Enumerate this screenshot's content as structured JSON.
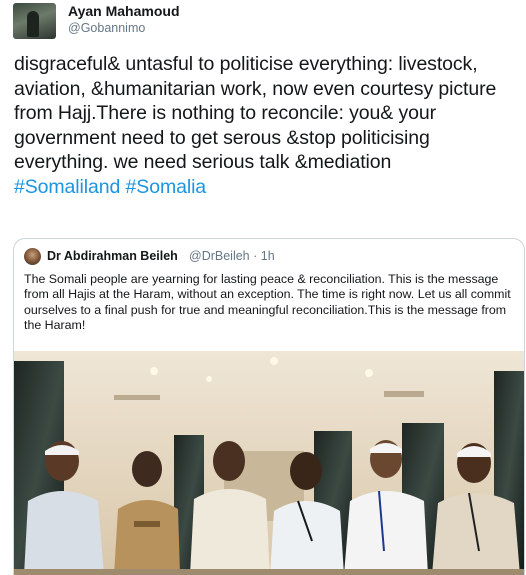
{
  "tweet": {
    "author_name": "Ayan Mahamoud",
    "author_handle": "@Gobannimo",
    "text": "disgraceful& untasful to politicise everything: livestock, aviation, &humanitarian work, now even courtesy picture from Hajj.There is nothing to reconcile: you& your government need to get serous &stop politicising everything. we need serious talk &mediation",
    "hashtags": [
      "#Somaliland",
      "#Somalia"
    ]
  },
  "quoted": {
    "author_name": "Dr Abdirahman Beileh",
    "author_handle": "@DrBeileh",
    "separator": "·",
    "time": "1h",
    "text": "The Somali people are yearning  for lasting peace & reconciliation. This is the message from all Hajis at the Haram, without an exception. The time is right now. Let us all commit ourselves to a final push for true and meaningful reconciliation.This is the message from the Haram!"
  },
  "colors": {
    "accent": "#1b95e0",
    "muted": "#657786",
    "border": "#ccd6dd"
  }
}
